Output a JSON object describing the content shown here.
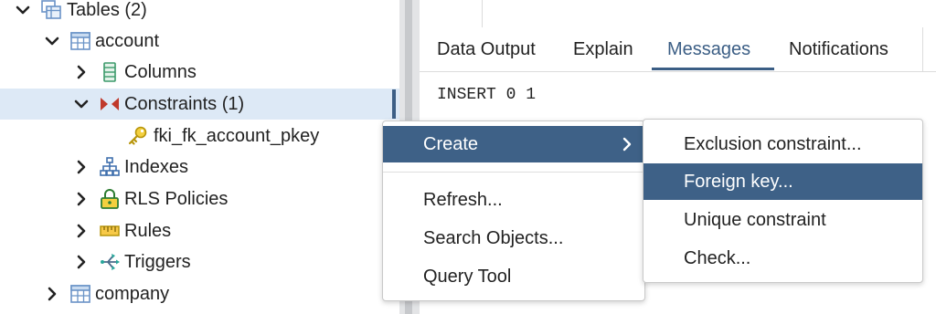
{
  "tree": {
    "items": [
      {
        "label": "Tables (2)",
        "icon": "tables-icon",
        "state": "expanded"
      },
      {
        "label": "account",
        "icon": "table-icon",
        "state": "expanded"
      },
      {
        "label": "Columns",
        "icon": "columns-icon",
        "state": "collapsed"
      },
      {
        "label": "Constraints (1)",
        "icon": "constraints-icon",
        "state": "expanded",
        "selected": true
      },
      {
        "label": "fki_fk_account_pkey",
        "icon": "key-icon",
        "state": "leaf"
      },
      {
        "label": "Indexes",
        "icon": "indexes-icon",
        "state": "collapsed"
      },
      {
        "label": "RLS Policies",
        "icon": "lock-icon",
        "state": "collapsed"
      },
      {
        "label": "Rules",
        "icon": "rules-icon",
        "state": "collapsed"
      },
      {
        "label": "Triggers",
        "icon": "triggers-icon",
        "state": "collapsed"
      },
      {
        "label": "company",
        "icon": "table-icon",
        "state": "collapsed"
      }
    ]
  },
  "tabs": [
    {
      "label": "Data Output",
      "active": false
    },
    {
      "label": "Explain",
      "active": false
    },
    {
      "label": "Messages",
      "active": true
    },
    {
      "label": "Notifications",
      "active": false
    }
  ],
  "messages": {
    "text": "INSERT 0 1"
  },
  "context_menu": {
    "items": [
      {
        "label": "Create",
        "highlighted": true,
        "has_submenu": true
      },
      {
        "label": "Refresh..."
      },
      {
        "label": "Search Objects..."
      },
      {
        "label": "Query Tool"
      }
    ]
  },
  "submenu": {
    "items": [
      {
        "label": "Exclusion constraint..."
      },
      {
        "label": "Foreign key...",
        "highlighted": true
      },
      {
        "label": "Unique constraint"
      },
      {
        "label": "Check..."
      }
    ]
  },
  "colors": {
    "selection_row": "#dde9f6",
    "menu_highlight": "#3e6187",
    "active_tab": "#3b5e85",
    "splitter": "#e3e4e6"
  }
}
